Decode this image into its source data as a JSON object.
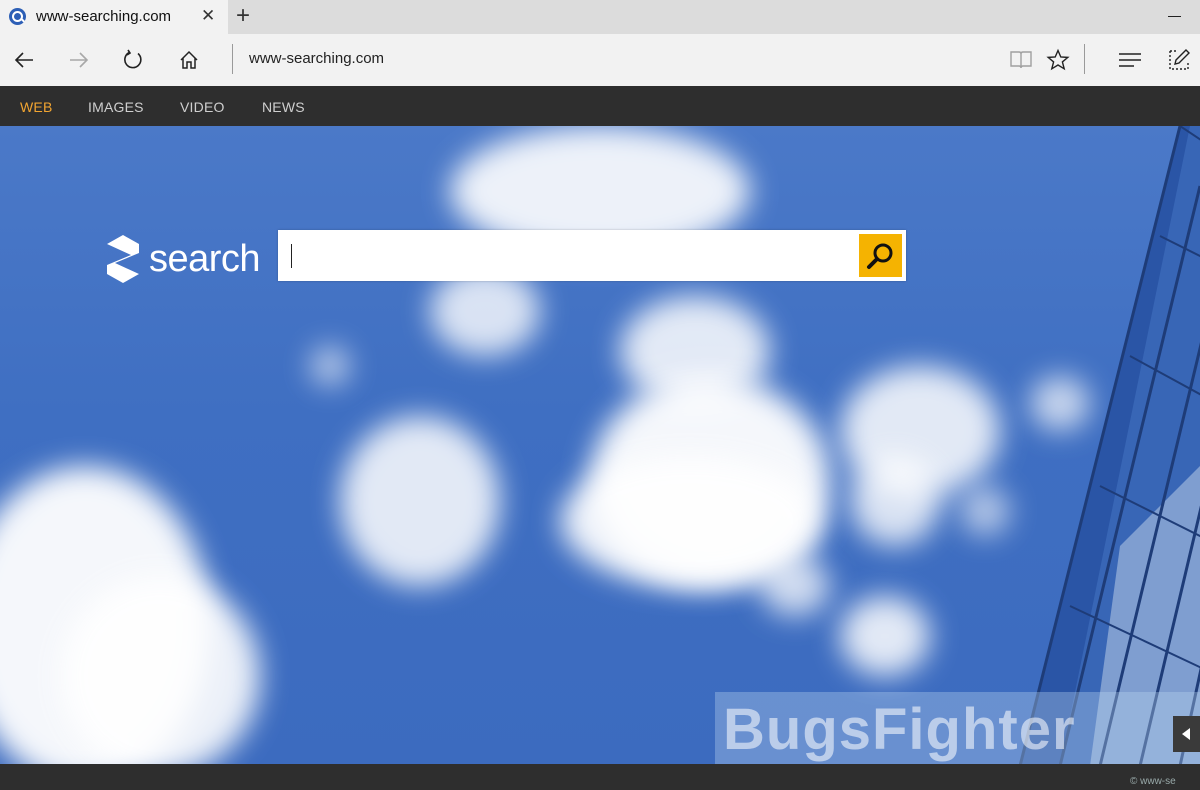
{
  "tab": {
    "title": "www-searching.com",
    "close": "✕",
    "new_tab": "+"
  },
  "nav": {
    "address": "www-searching.com"
  },
  "site_menu": [
    {
      "label": "WEB",
      "active": true
    },
    {
      "label": "IMAGES",
      "active": false
    },
    {
      "label": "VIDEO",
      "active": false
    },
    {
      "label": "NEWS",
      "active": false
    }
  ],
  "logo": {
    "text": "search"
  },
  "search": {
    "value": "",
    "button_icon": "search-icon"
  },
  "watermark": {
    "text": "BugsFighter",
    "copyright": "© www-se"
  },
  "colors": {
    "accent": "#f5b301",
    "active_menu": "#f2a531",
    "menu_bg": "#2e2e2e",
    "sky": "#4274c4"
  }
}
